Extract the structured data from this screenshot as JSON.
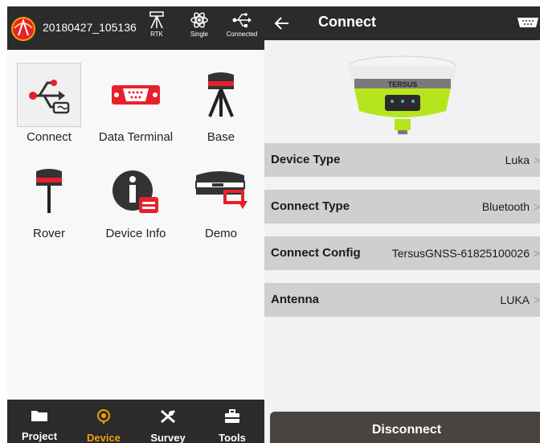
{
  "home": {
    "project_name": "20180427_105136",
    "status": {
      "rtk_label": "RTK",
      "solution_label": "Single",
      "link_label": "Connected"
    },
    "tiles": [
      {
        "label": "Connect",
        "icon": "usb-icon"
      },
      {
        "label": "Data Terminal",
        "icon": "serial-port-icon"
      },
      {
        "label": "Base",
        "icon": "base-station-icon"
      },
      {
        "label": "Rover",
        "icon": "rover-icon"
      },
      {
        "label": "Device Info",
        "icon": "info-icon"
      },
      {
        "label": "Demo",
        "icon": "demo-icon"
      }
    ],
    "nav": [
      {
        "label": "Project",
        "icon": "folder-icon"
      },
      {
        "label": "Device",
        "icon": "device-icon"
      },
      {
        "label": "Survey",
        "icon": "survey-icon"
      },
      {
        "label": "Tools",
        "icon": "toolbox-icon"
      }
    ],
    "active_nav": "Device"
  },
  "connect": {
    "title": "Connect",
    "rows": [
      {
        "label": "Device Type",
        "value": "Luka"
      },
      {
        "label": "Connect Type",
        "value": "Bluetooth"
      },
      {
        "label": "Connect Config",
        "value": "TersusGNSS-61825100026"
      },
      {
        "label": "Antenna",
        "value": "LUKA"
      }
    ],
    "chevron": ">",
    "device_brand": "TERSUS",
    "disconnect_label": "Disconnect"
  },
  "colors": {
    "bar_dark": "#2b2b2b",
    "accent_orange": "#f5a000",
    "row_gray": "#cfcfcf",
    "receiver_green": "#b5e61d",
    "icon_red": "#e8202b"
  }
}
